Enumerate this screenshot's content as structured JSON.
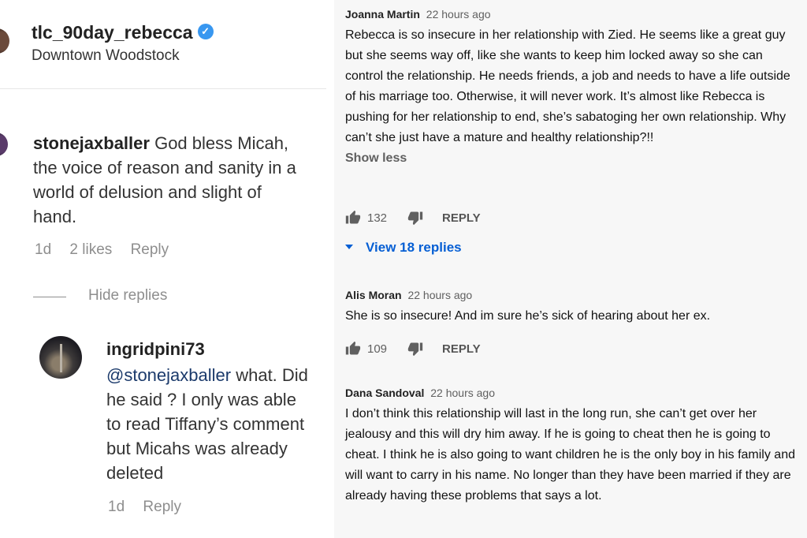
{
  "instagram": {
    "post": {
      "username": "tlc_90day_rebecca",
      "location": "Downtown Woodstock"
    },
    "comment": {
      "username": "stonejaxballer",
      "text": "God bless Micah, the voice of reason and sanity in a world of delusion and slight of hand.",
      "time": "1d",
      "likes": "2 likes",
      "reply_label": "Reply"
    },
    "hide_replies_label": "Hide replies",
    "reply": {
      "username": "ingridpini73",
      "mention": "@stonejaxballer",
      "text": " what. Did he said ? I only was able to read Tiffany’s comment but Micahs was already deleted",
      "time": "1d",
      "reply_label": "Reply"
    }
  },
  "youtube": {
    "comments": [
      {
        "author": "Joanna Martin",
        "time": "22 hours ago",
        "text": "Rebecca is so insecure in her relationship with Zied. He seems like a great guy but she seems way off, like she wants to keep him locked away so she can control the relationship.  He needs friends, a job and needs to have a life outside of his marriage too. Otherwise,  it will never work. It’s almost like Rebecca is pushing for her relationship to end, she’s sabatoging her own relationship. Why can’t she just have a mature and healthy relationship?!!",
        "show_less": "Show less",
        "likes": "132",
        "reply_label": "REPLY",
        "view_replies": "View 18 replies"
      },
      {
        "author": "Alis Moran",
        "time": "22 hours ago",
        "text": "She is so insecure! And im sure he’s sick of hearing about her ex.",
        "likes": "109",
        "reply_label": "REPLY"
      },
      {
        "author": "Dana Sandoval",
        "time": "22 hours ago",
        "text": "I don’t think this relationship will last in the long run, she can’t get over her jealousy and this will dry him away.  If he is going to cheat then he is going to cheat.  I think he is also going to want children he is the only boy in his family and will want to carry in his name. No longer than they have been married if they are already having these problems that says a lot."
      }
    ]
  },
  "icons": [
    "verified-badge-icon",
    "thumbs-up-icon",
    "thumbs-down-icon",
    "expand-triangle-icon"
  ],
  "colors": {
    "verified": "#3897f0",
    "link_blue": "#065fd4",
    "muted": "#8e8e8e"
  }
}
